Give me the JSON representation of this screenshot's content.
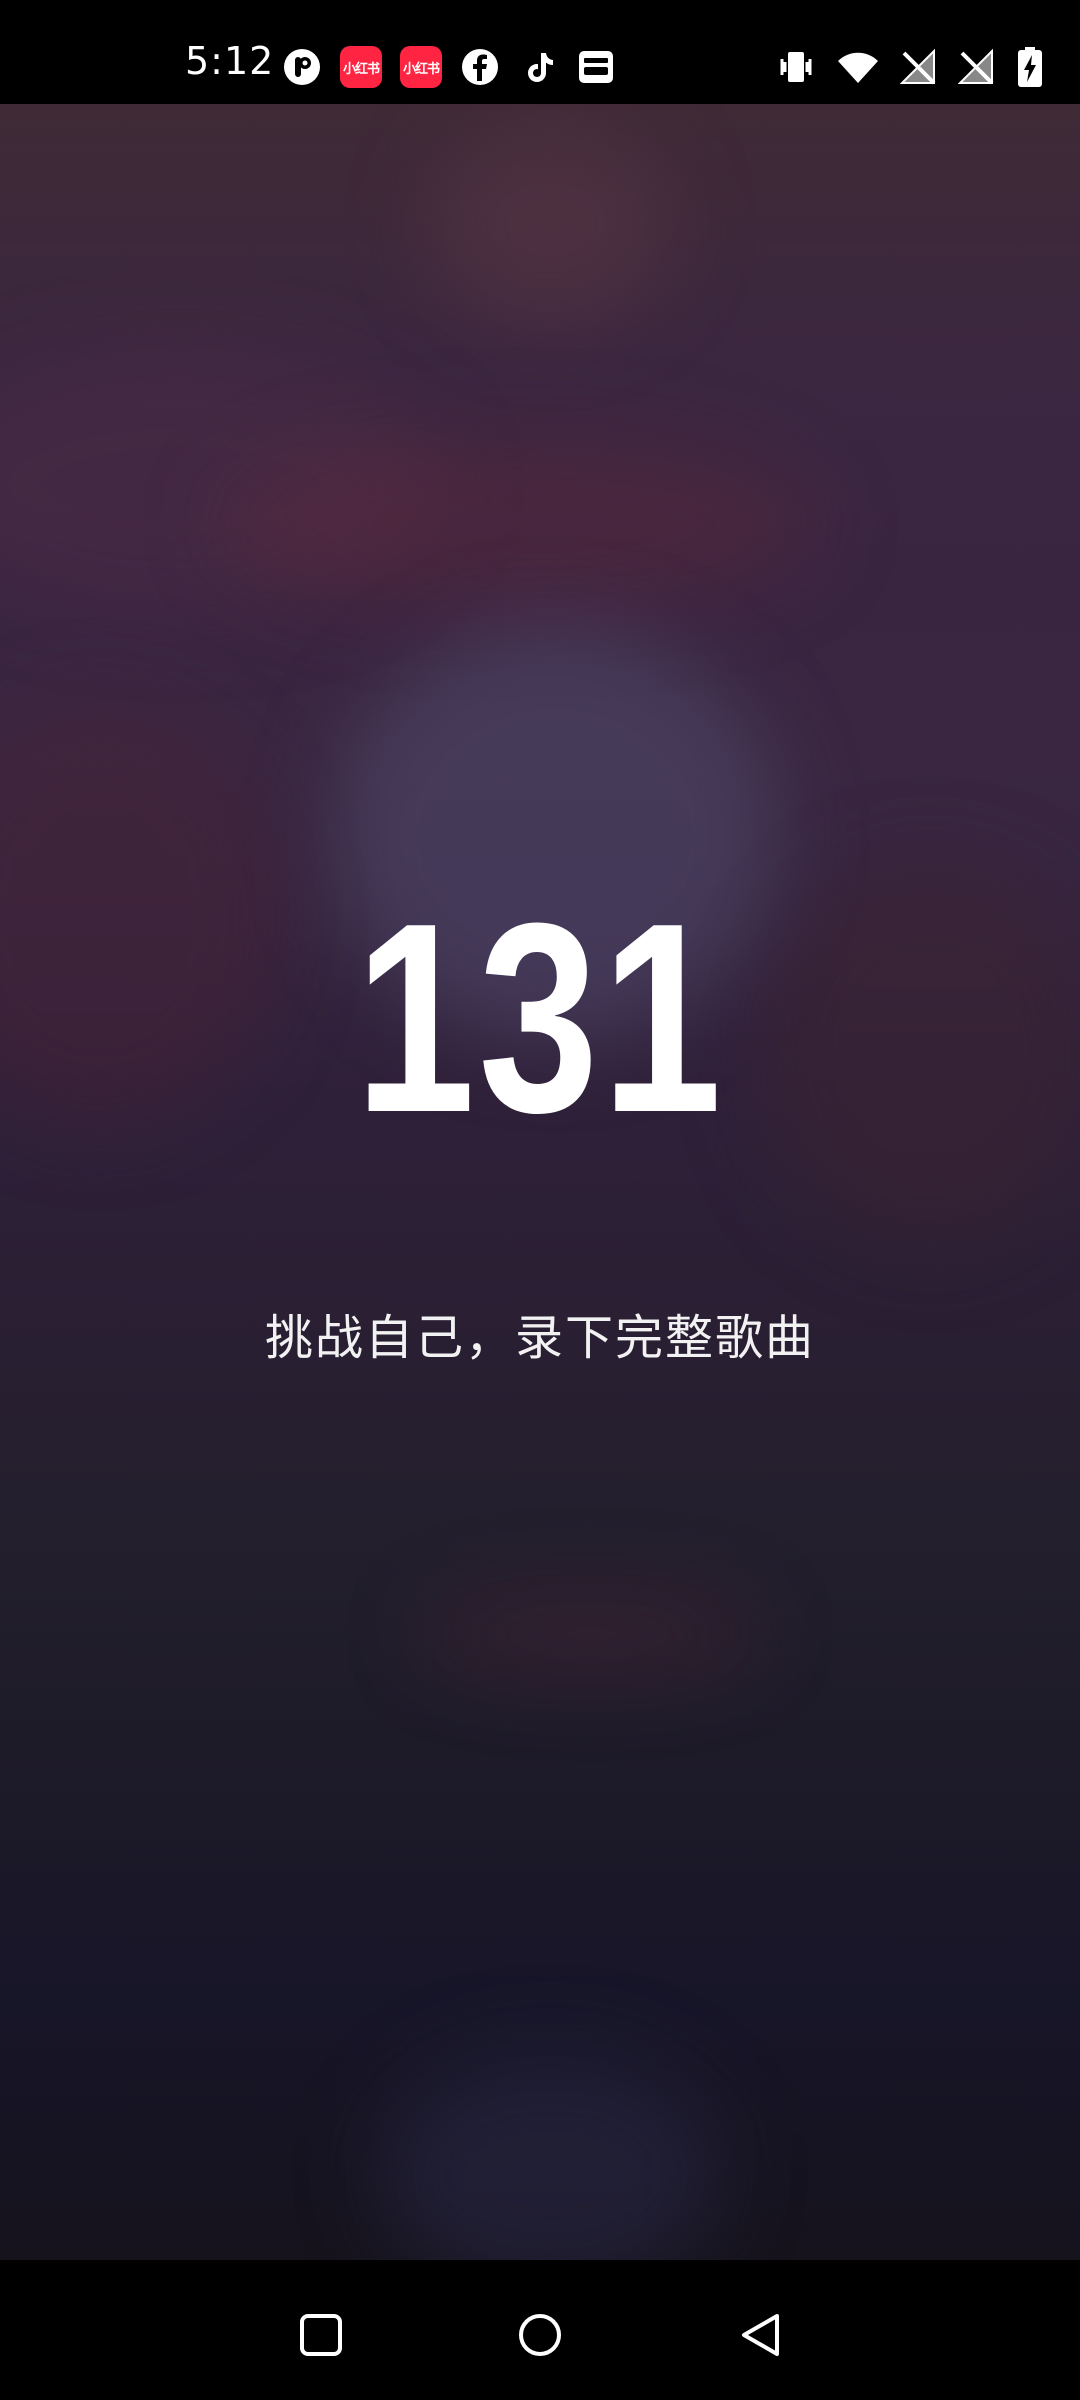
{
  "status_bar": {
    "time": "5:12",
    "notification_icons": [
      "pinterest-like-icon",
      "xiaohongshu-icon",
      "xiaohongshu-icon",
      "facebook-icon",
      "tiktok-icon",
      "wallet-icon"
    ],
    "xiaohongshu_label": "小红书",
    "system_icons": [
      "vibrate-icon",
      "wifi-icon",
      "no-signal-icon",
      "no-signal-icon",
      "battery-charging-icon"
    ]
  },
  "main": {
    "counter": "131",
    "subtitle": "挑战自己，录下完整歌曲"
  },
  "nav": {
    "buttons": [
      "recents-button",
      "home-button",
      "back-button"
    ]
  },
  "colors": {
    "brand_red": "#ff2442",
    "text_white": "#ffffff",
    "bg_top": "#3f2a36",
    "bg_bottom": "#16131d"
  }
}
